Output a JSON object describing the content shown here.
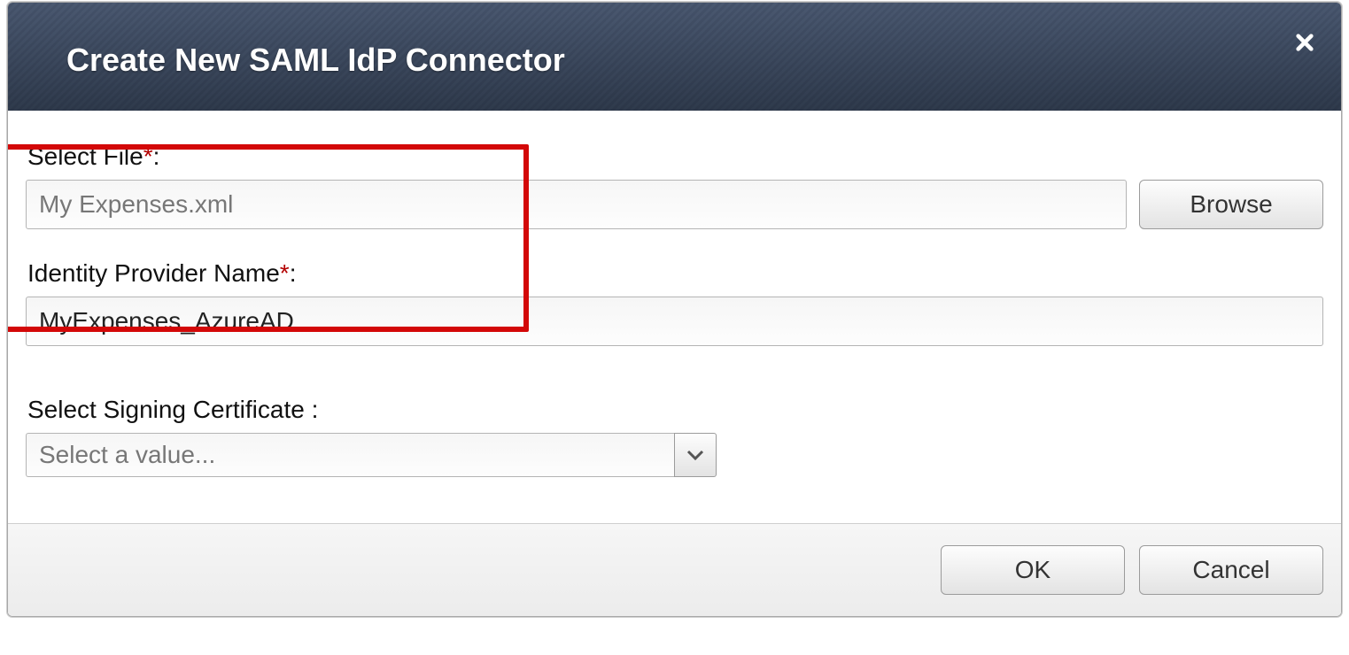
{
  "dialog": {
    "title": "Create New SAML IdP Connector"
  },
  "fields": {
    "selectFile": {
      "label": "Select File",
      "required": "*",
      "value": "My Expenses.xml",
      "browse": "Browse"
    },
    "idpName": {
      "label": "Identity Provider Name",
      "required": "*",
      "value": "MyExpenses_AzureAD"
    },
    "signingCert": {
      "label": "Select Signing Certificate ",
      "placeholder": "Select a value..."
    }
  },
  "buttons": {
    "ok": "OK",
    "cancel": "Cancel"
  }
}
